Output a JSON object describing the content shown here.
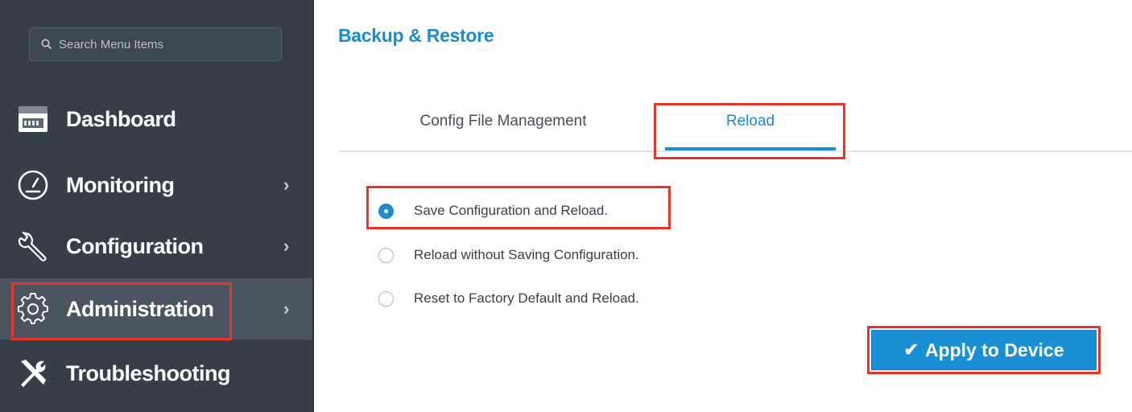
{
  "search": {
    "placeholder": "Search Menu Items",
    "icon": "search-icon"
  },
  "sidebar": {
    "items": [
      {
        "label": "Dashboard",
        "icon": "dashboard-icon",
        "chevron": ""
      },
      {
        "label": "Monitoring",
        "icon": "gauge-icon",
        "chevron": "›"
      },
      {
        "label": "Configuration",
        "icon": "wrench-icon",
        "chevron": "›"
      },
      {
        "label": "Administration",
        "icon": "gear-icon",
        "chevron": "›",
        "active": true
      },
      {
        "label": "Troubleshooting",
        "icon": "tools-icon",
        "chevron": ""
      }
    ]
  },
  "main": {
    "title": "Backup & Restore",
    "tabs": [
      {
        "label": "Config File Management"
      },
      {
        "label": "Reload",
        "active": true
      }
    ],
    "options": [
      {
        "label": "Save Configuration and Reload.",
        "checked": true
      },
      {
        "label": "Reload without Saving Configuration.",
        "checked": false
      },
      {
        "label": "Reset to Factory Default and Reload.",
        "checked": false
      }
    ],
    "apply_button": {
      "label": "Apply to Device",
      "icon": "checkmark-icon"
    }
  },
  "colors": {
    "sidebar_bg": "#363f48",
    "sidebar_active": "#4b5560",
    "accent": "#1f8ad0",
    "highlight": "#e8352a"
  }
}
